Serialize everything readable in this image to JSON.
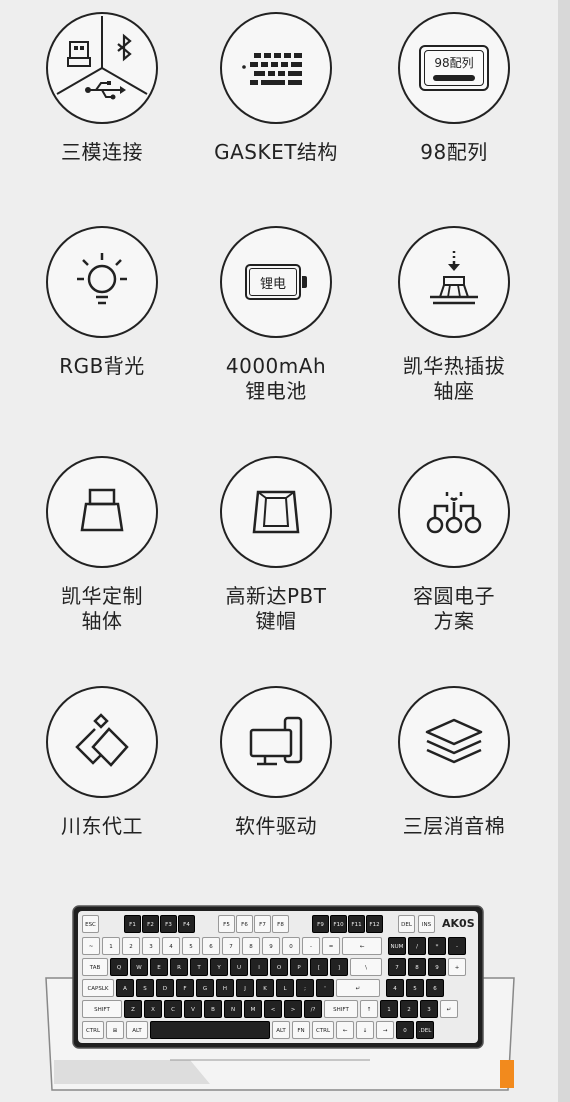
{
  "features": [
    {
      "id": "tri-mode",
      "icon": "tri-mode-connection-icon",
      "lines": [
        "三模连接"
      ]
    },
    {
      "id": "gasket",
      "icon": "gasket-structure-icon",
      "lines": [
        "GASKET结构"
      ]
    },
    {
      "id": "layout98",
      "icon": "98-layout-icon",
      "badge": "98配列",
      "lines": [
        "98配列"
      ]
    },
    {
      "id": "rgb",
      "icon": "rgb-light-bulb-icon",
      "lines": [
        "RGB背光"
      ]
    },
    {
      "id": "battery",
      "icon": "lithium-battery-icon",
      "badge": "锂电",
      "lines": [
        "4000mAh",
        "锂电池"
      ]
    },
    {
      "id": "hotswap",
      "icon": "hot-swap-socket-icon",
      "lines": [
        "凯华热插拔",
        "轴座"
      ]
    },
    {
      "id": "custom-switch",
      "icon": "custom-switch-icon",
      "lines": [
        "凯华定制",
        "轴体"
      ]
    },
    {
      "id": "pbt",
      "icon": "pbt-keycap-icon",
      "lines": [
        "高新达PBT",
        "键帽"
      ]
    },
    {
      "id": "solution",
      "icon": "chip-solution-icon",
      "lines": [
        "容圆电子",
        "方案"
      ]
    },
    {
      "id": "cardboard",
      "icon": "layered-diamond-icon",
      "lines": [
        "川东代工"
      ]
    },
    {
      "id": "driver",
      "icon": "software-driver-icon",
      "lines": [
        "软件驱动"
      ]
    },
    {
      "id": "sound-foam",
      "icon": "sound-foam-layers-icon",
      "lines": [
        "三层消音棉"
      ]
    }
  ],
  "keyboard": {
    "brand": "AK0S",
    "frow": [
      "ESC",
      "F1",
      "F2",
      "F3",
      "F4",
      "F5",
      "F6",
      "F7",
      "F8",
      "F9",
      "F10",
      "F11",
      "F12",
      "DEL",
      "INS"
    ],
    "row1": [
      "~",
      "1",
      "2",
      "3",
      "4",
      "5",
      "6",
      "7",
      "8",
      "9",
      "0",
      "-",
      "=",
      "←",
      "NUM",
      "/",
      "*",
      "-"
    ],
    "row2": [
      "TAB",
      "Q",
      "W",
      "E",
      "R",
      "T",
      "Y",
      "U",
      "I",
      "O",
      "P",
      "[",
      "]",
      "\\",
      "7",
      "8",
      "9",
      "+"
    ],
    "row3": [
      "CAPSLK",
      "A",
      "S",
      "D",
      "F",
      "G",
      "H",
      "J",
      "K",
      "L",
      ";",
      "'",
      "↵",
      "4",
      "5",
      "6"
    ],
    "row4": [
      "SHIFT",
      "Z",
      "X",
      "C",
      "V",
      "B",
      "N",
      "M",
      "<",
      ">",
      "/?",
      "SHIFT",
      "↑",
      "1",
      "2",
      "3",
      "↵"
    ],
    "row5": [
      "CTRL",
      "⊞",
      "ALT",
      "",
      "ALT",
      "FN",
      "CTRL",
      "←",
      "↓",
      "→",
      "0",
      ".DEL"
    ]
  }
}
